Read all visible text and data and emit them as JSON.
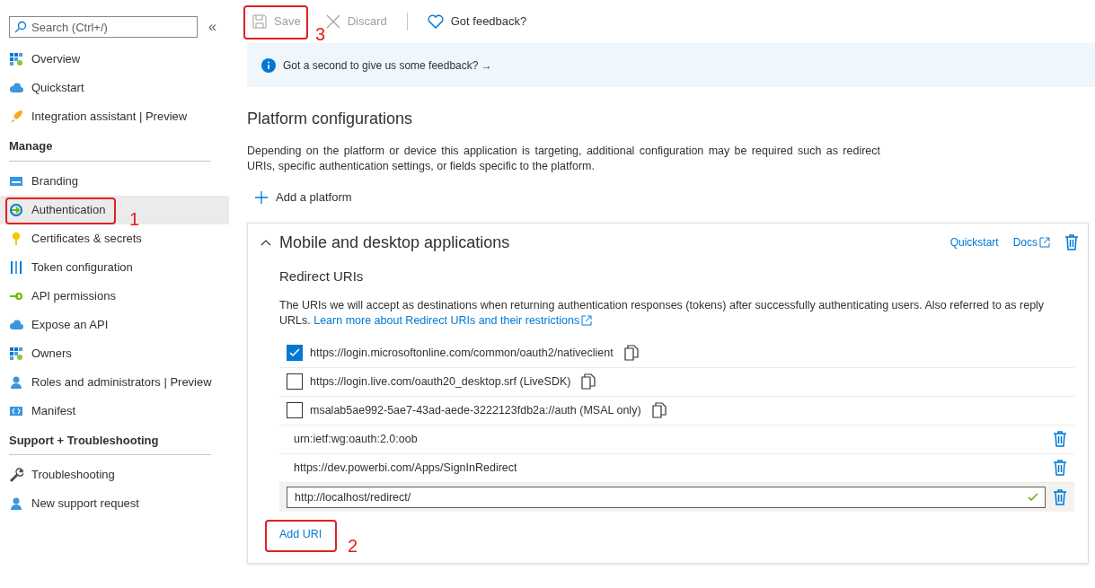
{
  "sidebar": {
    "search": {
      "placeholder": "Search (Ctrl+/)"
    },
    "collapse_glyph": "«",
    "groups": [
      {
        "items": [
          {
            "label": "Overview",
            "selected": false
          },
          {
            "label": "Quickstart",
            "selected": false
          },
          {
            "label": "Integration assistant | Preview",
            "selected": false
          }
        ]
      },
      {
        "heading": "Manage",
        "items": [
          {
            "label": "Branding",
            "selected": false
          },
          {
            "label": "Authentication",
            "selected": true,
            "annotation": "1"
          },
          {
            "label": "Certificates & secrets",
            "selected": false
          },
          {
            "label": "Token configuration",
            "selected": false
          },
          {
            "label": "API permissions",
            "selected": false
          },
          {
            "label": "Expose an API",
            "selected": false
          },
          {
            "label": "Owners",
            "selected": false
          },
          {
            "label": "Roles and administrators | Preview",
            "selected": false
          },
          {
            "label": "Manifest",
            "selected": false
          }
        ]
      },
      {
        "heading": "Support + Troubleshooting",
        "items": [
          {
            "label": "Troubleshooting",
            "selected": false
          },
          {
            "label": "New support request",
            "selected": false
          }
        ]
      }
    ]
  },
  "toolbar": [
    {
      "label": "Save",
      "kind": "save",
      "disabled": true,
      "annotation": "3"
    },
    {
      "label": "Discard",
      "kind": "discard",
      "disabled": true
    },
    {
      "label": "Got feedback?",
      "kind": "feedback",
      "disabled": false
    }
  ],
  "banner": {
    "text": "Got a second to give us some feedback?",
    "arrow": "→"
  },
  "section": {
    "title": "Platform configurations",
    "description": "Depending on the platform or device this application is targeting, additional configuration may be required such as redirect URIs, specific authentication settings, or fields specific to the platform.",
    "add_platform": "Add a platform"
  },
  "platform_card": {
    "title": "Mobile and desktop applications",
    "expanded": true,
    "links": [
      "Quickstart",
      "Docs"
    ],
    "redirect_uris": {
      "heading": "Redirect URIs",
      "description": "The URIs we will accept as destinations when returning authentication responses (tokens) after successfully authenticating users. Also referred to as reply URLs.",
      "learn_more": "Learn more about Redirect URIs and their restrictions",
      "rows": [
        {
          "kind": "checkbox",
          "uri": "https://login.microsoftonline.com/common/oauth2/nativeclient",
          "checked": true
        },
        {
          "kind": "checkbox",
          "uri": "https://login.live.com/oauth20_desktop.srf (LiveSDK)",
          "checked": false
        },
        {
          "kind": "checkbox",
          "uri": "msalab5ae992-5ae7-43ad-aede-3222123fdb2a://auth (MSAL only)",
          "checked": false
        },
        {
          "kind": "uri",
          "uri": "urn:ietf:wg:oauth:2.0:oob"
        },
        {
          "kind": "uri",
          "uri": "https://dev.powerbi.com/Apps/SignInRedirect"
        },
        {
          "kind": "input",
          "uri": "http://localhost/redirect/",
          "valid": true
        }
      ]
    },
    "add_uri": {
      "label": "Add URI",
      "annotation": "2"
    }
  }
}
